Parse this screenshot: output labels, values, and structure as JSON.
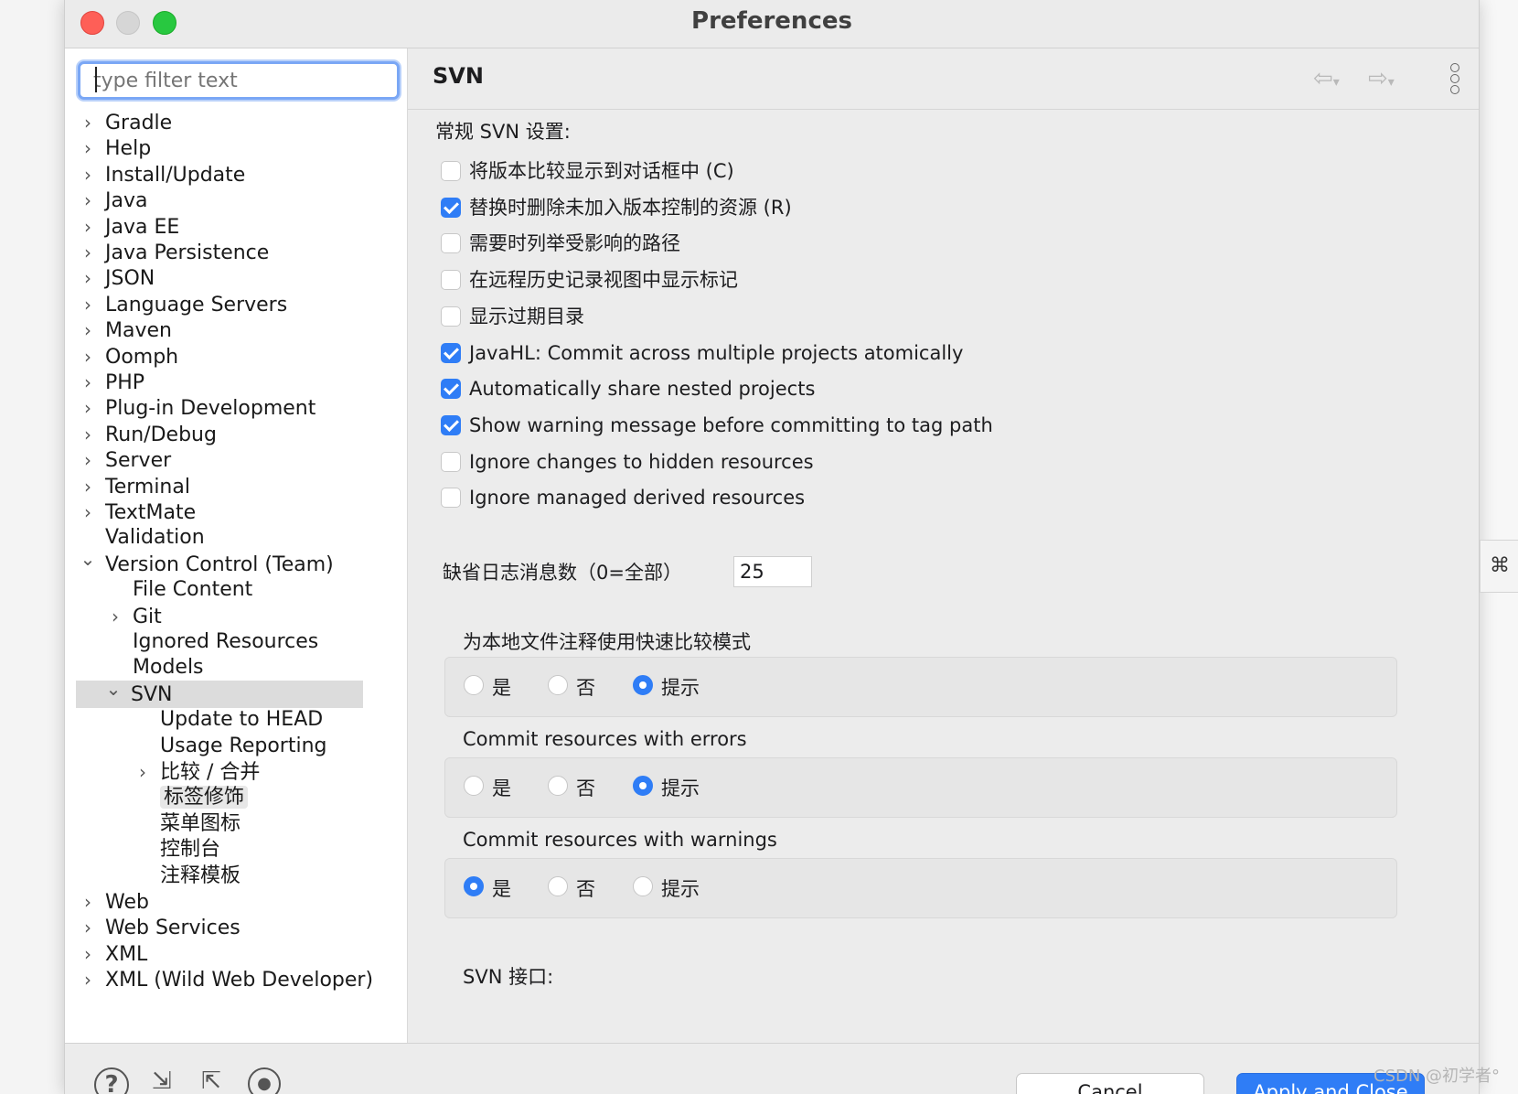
{
  "window": {
    "title": "Preferences"
  },
  "sidebar": {
    "filter_placeholder": "type filter text",
    "items": [
      {
        "label": "Gradle",
        "expander": "collapsed"
      },
      {
        "label": "Help",
        "expander": "collapsed"
      },
      {
        "label": "Install/Update",
        "expander": "collapsed"
      },
      {
        "label": "Java",
        "expander": "collapsed"
      },
      {
        "label": "Java EE",
        "expander": "collapsed"
      },
      {
        "label": "Java Persistence",
        "expander": "collapsed"
      },
      {
        "label": "JSON",
        "expander": "collapsed"
      },
      {
        "label": "Language Servers",
        "expander": "collapsed"
      },
      {
        "label": "Maven",
        "expander": "collapsed"
      },
      {
        "label": "Oomph",
        "expander": "collapsed"
      },
      {
        "label": "PHP",
        "expander": "collapsed"
      },
      {
        "label": "Plug-in Development",
        "expander": "collapsed"
      },
      {
        "label": "Run/Debug",
        "expander": "collapsed"
      },
      {
        "label": "Server",
        "expander": "collapsed"
      },
      {
        "label": "Terminal",
        "expander": "collapsed"
      },
      {
        "label": "TextMate",
        "expander": "collapsed"
      },
      {
        "label": "Validation",
        "expander": "none"
      },
      {
        "label": "Version Control (Team)",
        "expander": "expanded"
      },
      {
        "label": "File Content",
        "expander": "none"
      },
      {
        "label": "Git",
        "expander": "collapsed"
      },
      {
        "label": "Ignored Resources",
        "expander": "none"
      },
      {
        "label": "Models",
        "expander": "none"
      },
      {
        "label": "SVN",
        "expander": "expanded"
      },
      {
        "label": "Update to HEAD",
        "expander": "none"
      },
      {
        "label": "Usage Reporting",
        "expander": "none"
      },
      {
        "label": "比较 / 合并",
        "expander": "collapsed"
      },
      {
        "label": "标签修饰",
        "expander": "none"
      },
      {
        "label": "菜单图标",
        "expander": "none"
      },
      {
        "label": "控制台",
        "expander": "none"
      },
      {
        "label": "注释模板",
        "expander": "none"
      },
      {
        "label": "Web",
        "expander": "collapsed"
      },
      {
        "label": "Web Services",
        "expander": "collapsed"
      },
      {
        "label": "XML",
        "expander": "collapsed"
      },
      {
        "label": "XML (Wild Web Developer)",
        "expander": "collapsed"
      }
    ],
    "selected_item": "SVN",
    "hovered_item": "标签修饰"
  },
  "main": {
    "title": "SVN",
    "general_label": "常规 SVN 设置:",
    "checkboxes": [
      {
        "label": "将版本比较显示到对话框中 (C)",
        "checked": false
      },
      {
        "label": "替换时删除未加入版本控制的资源 (R)",
        "checked": true
      },
      {
        "label": "需要时列举受影响的路径",
        "checked": false
      },
      {
        "label": "在远程历史记录视图中显示标记",
        "checked": false
      },
      {
        "label": "显示过期目录",
        "checked": false
      },
      {
        "label": "JavaHL: Commit across multiple projects atomically",
        "checked": true
      },
      {
        "label": "Automatically share nested projects",
        "checked": true
      },
      {
        "label": "Show warning message before committing to tag path",
        "checked": true
      },
      {
        "label": "Ignore changes to hidden resources",
        "checked": false
      },
      {
        "label": "Ignore managed derived resources",
        "checked": false
      }
    ],
    "log_label": "缺省日志消息数（0=全部）",
    "log_value": "25",
    "radio_groups": [
      {
        "title": "为本地文件注释使用快速比较模式",
        "options": [
          "是",
          "否",
          "提示"
        ],
        "selected": "提示"
      },
      {
        "title": "Commit resources with errors",
        "options": [
          "是",
          "否",
          "提示"
        ],
        "selected": "提示"
      },
      {
        "title": "Commit resources with warnings",
        "options": [
          "是",
          "否",
          "提示"
        ],
        "selected": "是"
      }
    ],
    "next_section_label": "SVN 接口:"
  },
  "footer": {
    "cancel_label": "Cancel",
    "apply_label": "Apply and Close",
    "icons": [
      "help-icon",
      "import-icon",
      "export-icon",
      "oomph-icon"
    ]
  },
  "watermark": "CSDN @初学者°",
  "colors": {
    "accent": "#2f7df6",
    "selection": "#dcdcdc"
  }
}
